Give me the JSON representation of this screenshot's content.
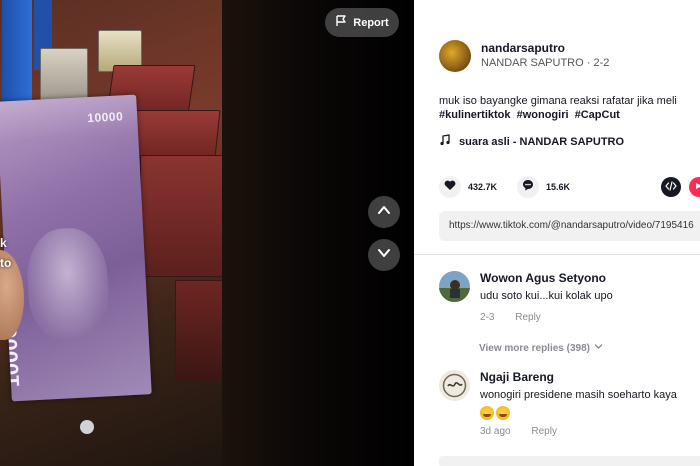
{
  "video": {
    "banknote_denomination": "10000",
    "overlay_line1": "k",
    "overlay_line2": "to"
  },
  "report_button": {
    "label": "Report"
  },
  "author": {
    "username": "nandarsaputro",
    "display_name": "NANDAR SAPUTRO",
    "date": "2-2",
    "separator": " · "
  },
  "caption": {
    "text": "muk iso bayangke gimana reaksi rafatar jika meli",
    "hashtags": [
      "#kulinertiktok",
      "#wonogiri",
      "#CapCut"
    ]
  },
  "music": {
    "label": "suara asli - NANDAR SAPUTRO"
  },
  "stats": {
    "likes": "432.7K",
    "comments": "15.6K"
  },
  "link": {
    "url": "https://www.tiktok.com/@nandarsaputro/video/7195416"
  },
  "comments": [
    {
      "name": "Wowon Agus Setyono",
      "text": "udu soto kui...kui kolak upo",
      "date": "2-3",
      "reply_label": "Reply"
    },
    {
      "name": "Ngaji Bareng",
      "text": "wonogiri presidene masih soeharto kaya",
      "date": "3d ago",
      "reply_label": "Reply"
    }
  ],
  "view_replies": {
    "label": "View more replies (398)"
  },
  "colors": {
    "accent": "#fe2c55",
    "text": "#161823",
    "muted": "#8a8b91"
  }
}
